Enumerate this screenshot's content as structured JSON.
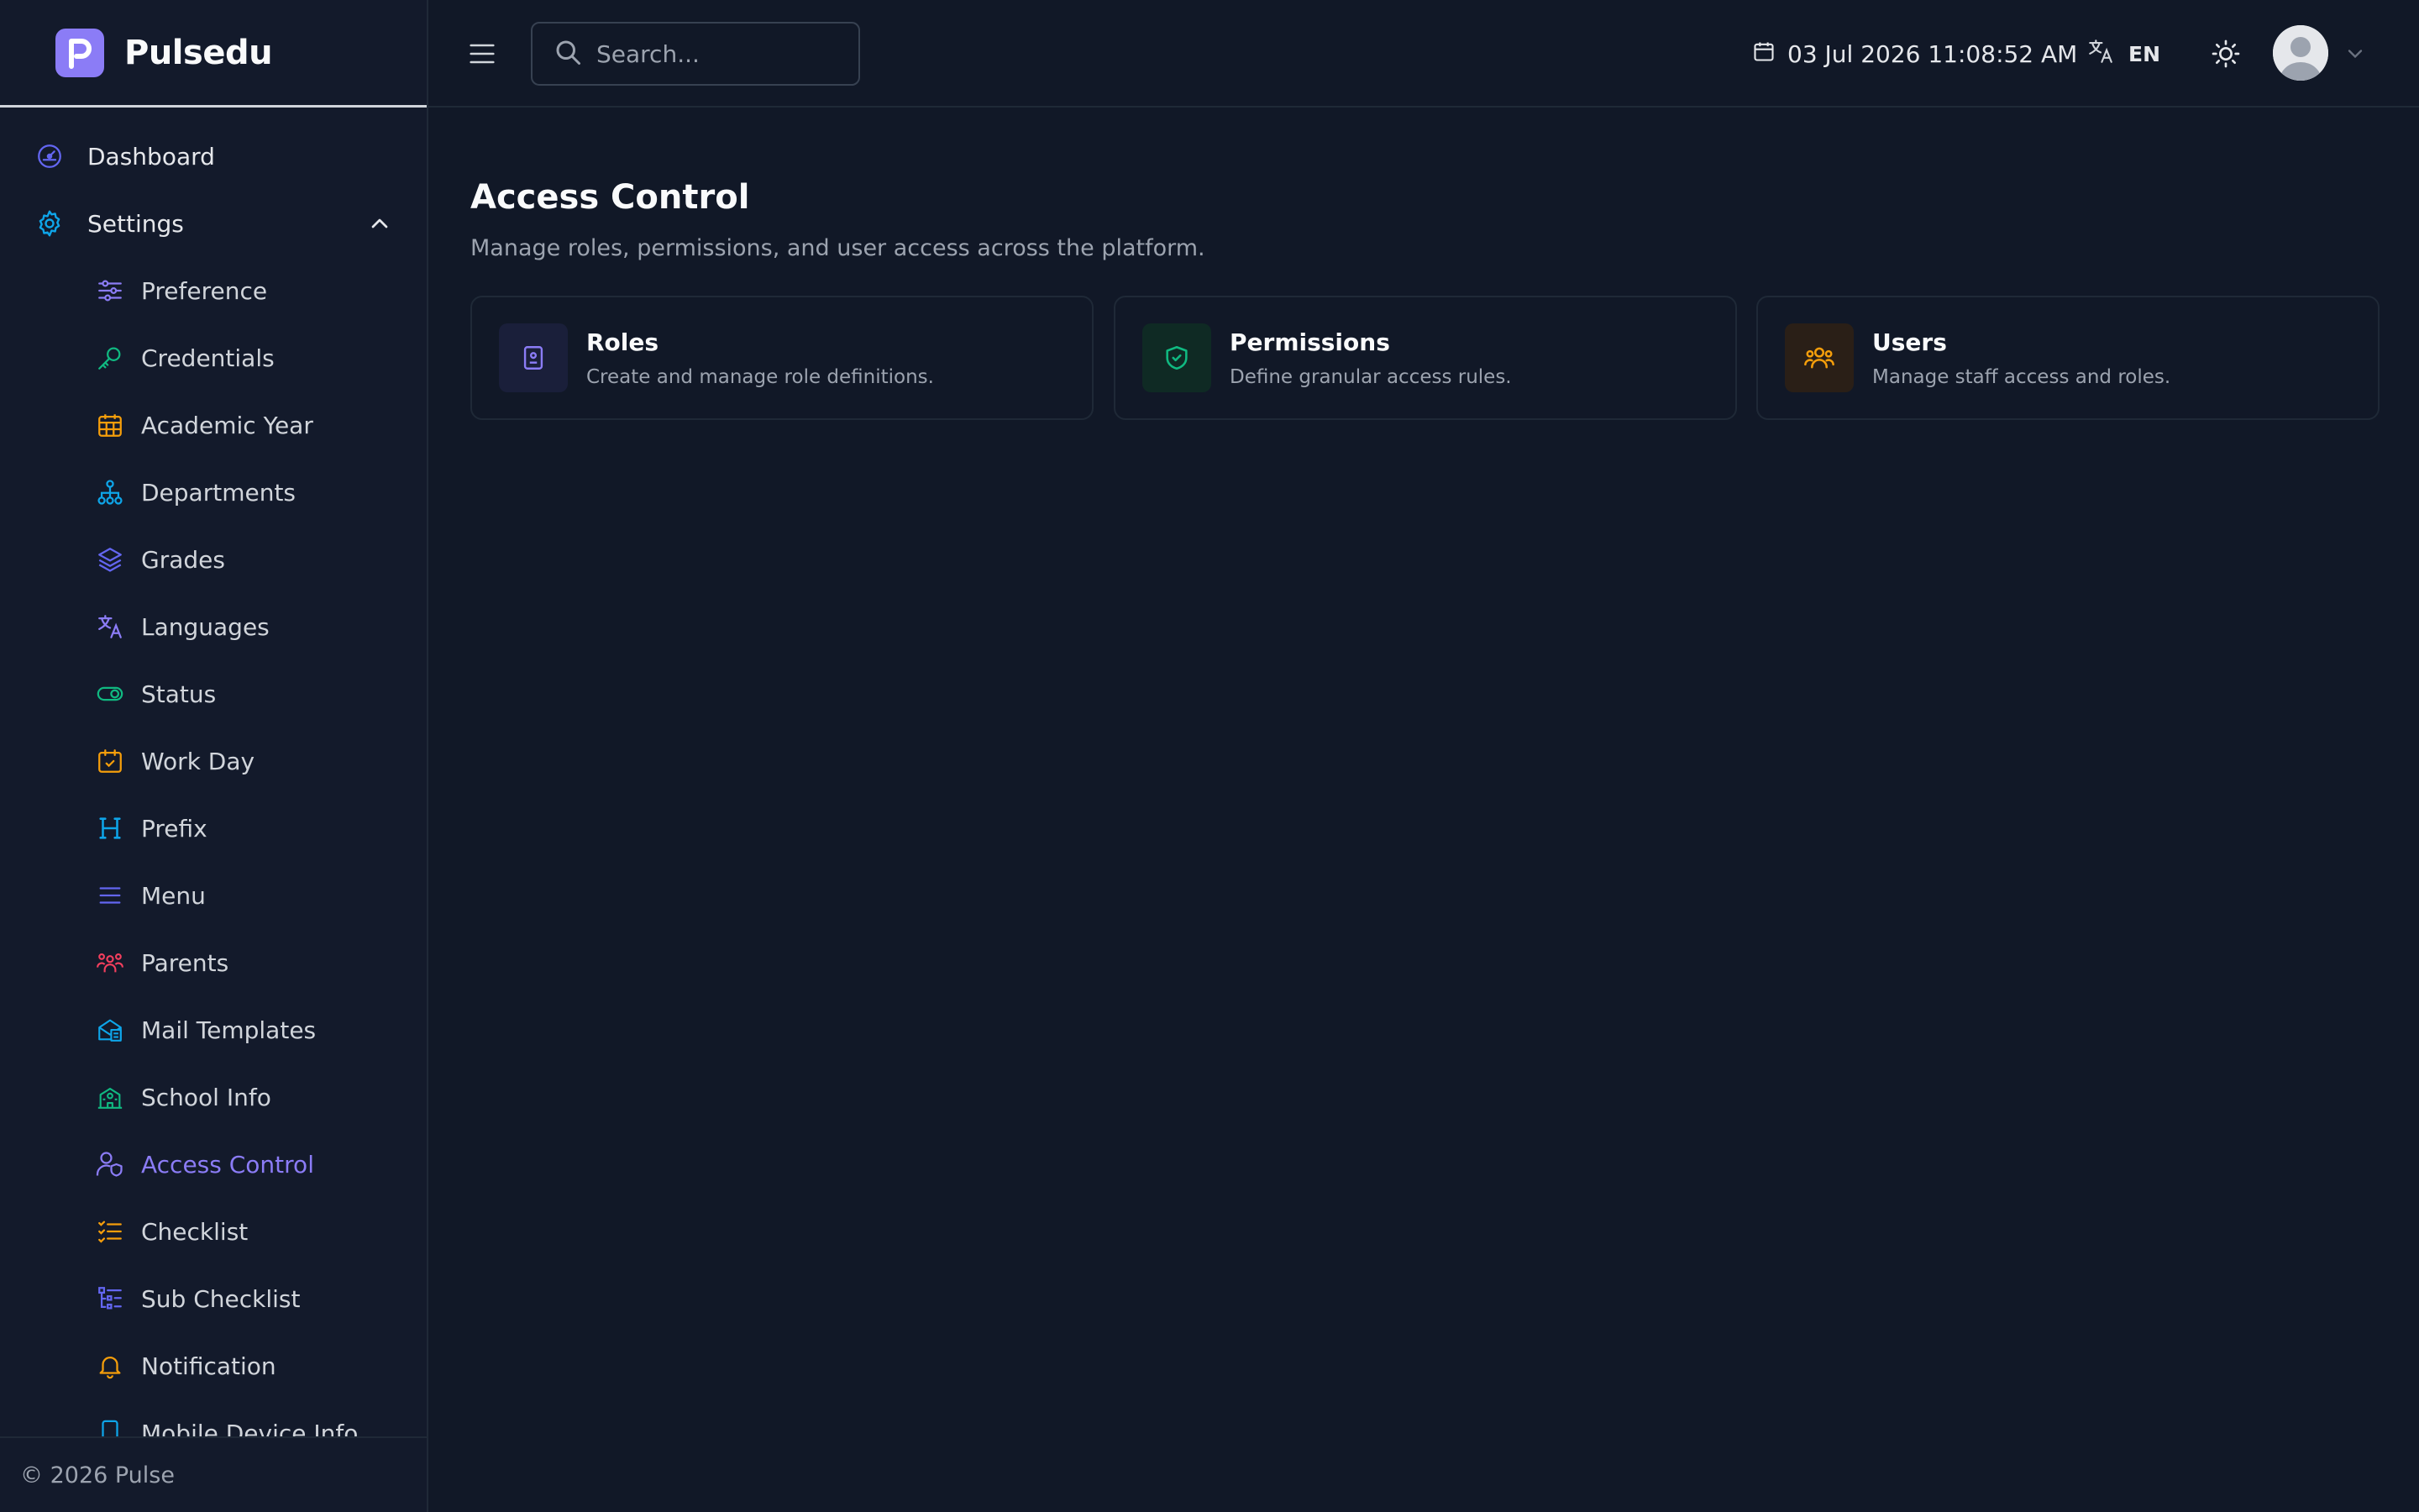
{
  "app": {
    "name": "Pulsedu"
  },
  "search": {
    "placeholder": "Search..."
  },
  "header": {
    "datetime": "03 Jul 2026 11:08:52 AM",
    "language": "EN"
  },
  "sidebar": {
    "top_items": [
      {
        "label": "Dashboard",
        "icon": "dashboard-icon"
      },
      {
        "label": "Settings",
        "icon": "gear-icon",
        "expanded": true
      }
    ],
    "settings_items": [
      {
        "label": "Preference",
        "icon": "sliders-icon",
        "color": "#8b7cf6"
      },
      {
        "label": "Credentials",
        "icon": "key-icon",
        "color": "#10b981"
      },
      {
        "label": "Academic Year",
        "icon": "calendar-grid-icon",
        "color": "#f59e0b"
      },
      {
        "label": "Departments",
        "icon": "hierarchy-icon",
        "color": "#0ea5e9"
      },
      {
        "label": "Grades",
        "icon": "layers-icon",
        "color": "#6366f1"
      },
      {
        "label": "Languages",
        "icon": "translate-icon",
        "color": "#8b7cf6"
      },
      {
        "label": "Status",
        "icon": "toggle-icon",
        "color": "#10b981"
      },
      {
        "label": "Work Day",
        "icon": "calendar-check-icon",
        "color": "#f59e0b"
      },
      {
        "label": "Prefix",
        "icon": "heading-icon",
        "color": "#0ea5e9"
      },
      {
        "label": "Menu",
        "icon": "menu-lines-icon",
        "color": "#6366f1"
      },
      {
        "label": "Parents",
        "icon": "family-icon",
        "color": "#f43f5e"
      },
      {
        "label": "Mail Templates",
        "icon": "mail-template-icon",
        "color": "#0ea5e9"
      },
      {
        "label": "School Info",
        "icon": "school-icon",
        "color": "#10b981"
      },
      {
        "label": "Access Control",
        "icon": "user-shield-icon",
        "color": "#8b7cf6",
        "active": true
      },
      {
        "label": "Checklist",
        "icon": "checklist-icon",
        "color": "#f59e0b"
      },
      {
        "label": "Sub Checklist",
        "icon": "sub-checklist-icon",
        "color": "#6366f1"
      },
      {
        "label": "Notification",
        "icon": "bell-icon",
        "color": "#f59e0b"
      },
      {
        "label": "Mobile Device Info",
        "icon": "mobile-icon",
        "color": "#0ea5e9"
      }
    ],
    "footer": "© 2026 Pulse"
  },
  "main": {
    "title": "Access Control",
    "subtitle": "Manage roles, permissions, and user access across the platform.",
    "cards": [
      {
        "title": "Roles",
        "description": "Create and manage role definitions.",
        "icon": "id-badge-icon",
        "color": "#8b7cf6"
      },
      {
        "title": "Permissions",
        "description": "Define granular access rules.",
        "icon": "shield-check-icon",
        "color": "#10b981"
      },
      {
        "title": "Users",
        "description": "Manage staff access and roles.",
        "icon": "users-icon",
        "color": "#f59e0b"
      }
    ]
  },
  "colors": {
    "accent": "#8b7cf6",
    "background": "#111827",
    "sidebar": "#131a2b"
  }
}
